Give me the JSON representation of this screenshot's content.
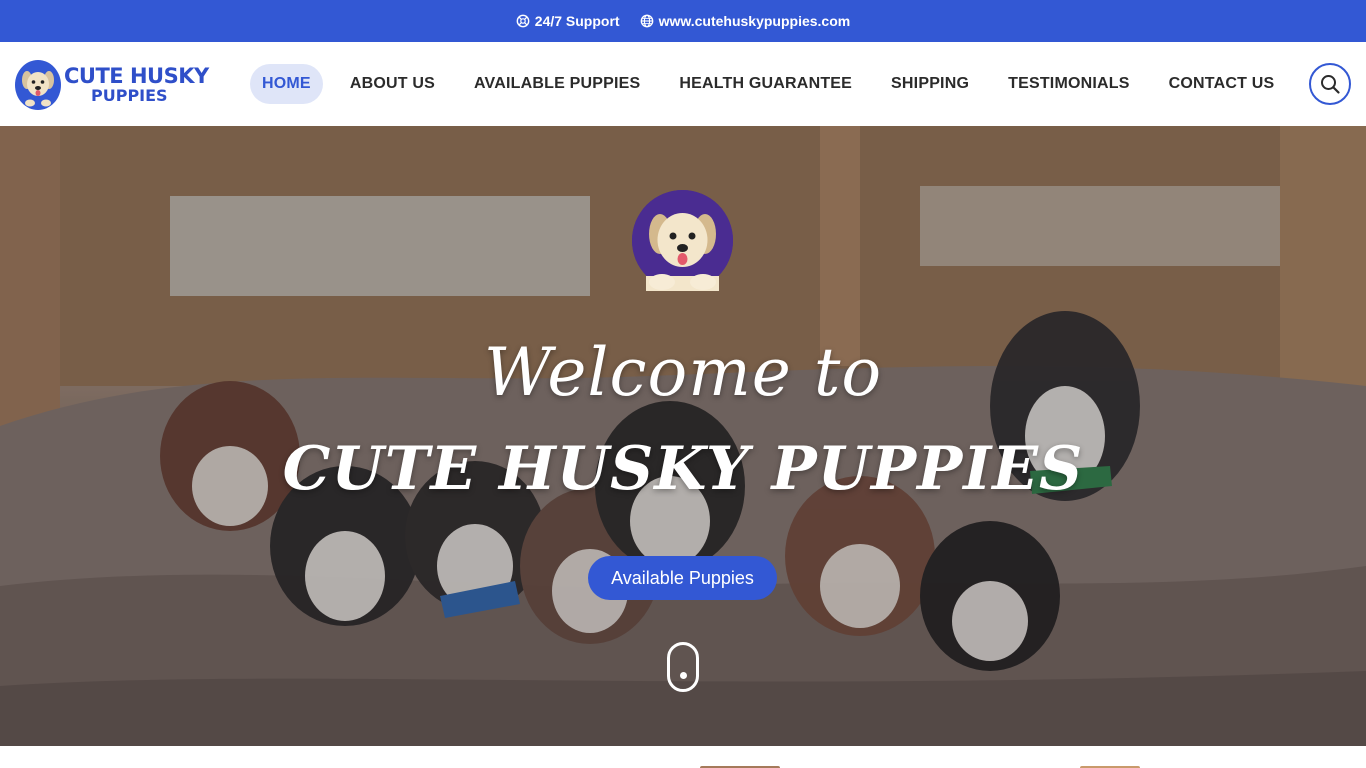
{
  "topbar": {
    "support_icon": "support-icon",
    "support_label": "24/7 Support",
    "web_icon": "globe-icon",
    "website_label": "www.cutehuskypuppies.com"
  },
  "brand": {
    "logo_icon": "puppy-logo-icon",
    "name_line1": "CUTE HUSKY",
    "name_line2": "PUPPIES",
    "color": "#2f4fc9"
  },
  "nav": {
    "items": [
      {
        "label": "HOME",
        "active": true
      },
      {
        "label": "ABOUT US",
        "active": false
      },
      {
        "label": "AVAILABLE PUPPIES",
        "active": false
      },
      {
        "label": "HEALTH GUARANTEE",
        "active": false
      },
      {
        "label": "SHIPPING",
        "active": false
      },
      {
        "label": "TESTIMONIALS",
        "active": false
      },
      {
        "label": "CONTACT US",
        "active": false
      }
    ],
    "search_icon": "search-icon"
  },
  "hero": {
    "avatar_icon": "puppy-avatar-icon",
    "title_line1": "Welcome to",
    "title_line2": "CUTE HUSKY PUPPIES",
    "cta_label": "Available Puppies",
    "scroll_icon": "mouse-scroll-icon"
  },
  "colors": {
    "accent": "#3358d4",
    "nav_text": "#2b2b2b",
    "active_bg": "#dfe5f8"
  }
}
